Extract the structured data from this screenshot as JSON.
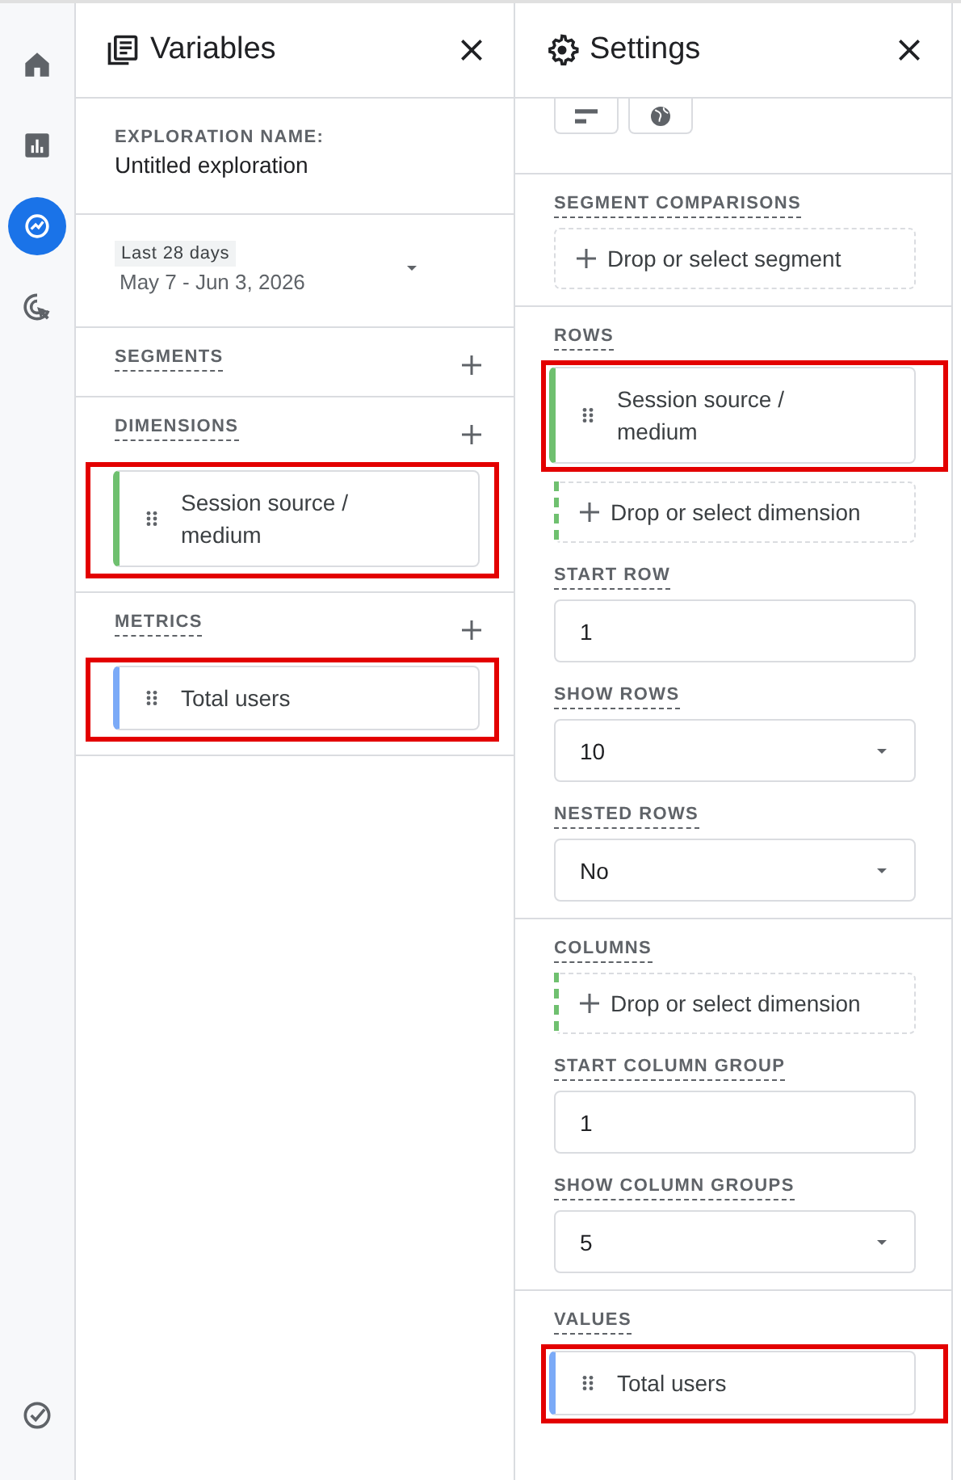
{
  "nav": {
    "items": [
      {
        "kind": "home",
        "selected": false
      },
      {
        "kind": "reports",
        "selected": false
      },
      {
        "kind": "explore",
        "selected": true
      },
      {
        "kind": "advertising",
        "selected": false
      }
    ],
    "bottom_items": [
      {
        "kind": "admin",
        "selected": false
      }
    ]
  },
  "variables_panel": {
    "title": "Variables",
    "exploration_name": {
      "label": "EXPLORATION NAME:",
      "value": "Untitled exploration"
    },
    "date_range": {
      "preset": "Last 28 days",
      "range": "May 7 - Jun 3, 2026"
    },
    "sections": [
      {
        "label": "SEGMENTS"
      },
      {
        "label": "DIMENSIONS",
        "chips": [
          {
            "text": "Session source / medium",
            "kind": "dimension",
            "highlighted": true
          }
        ]
      },
      {
        "label": "METRICS",
        "chips": [
          {
            "text": "Total users",
            "kind": "metric",
            "highlighted": true
          }
        ]
      }
    ]
  },
  "settings_panel": {
    "title": "Settings",
    "groups": [
      {
        "fields": [
          {
            "label": "SEGMENT COMPARISONS",
            "kind": "drop",
            "placeholder": "Drop or select segment"
          }
        ]
      },
      {
        "fields": [
          {
            "label": "ROWS",
            "kind": "drop",
            "color": "#6fc06f",
            "chips": [
              {
                "text": "Session source / medium",
                "kind": "dimension",
                "highlighted": true
              }
            ],
            "placeholder": "Drop or select dimension"
          },
          {
            "label": "START ROW",
            "kind": "input",
            "value": "1"
          },
          {
            "label": "SHOW ROWS",
            "kind": "select",
            "value": "10"
          },
          {
            "label": "NESTED ROWS",
            "kind": "select",
            "value": "No"
          }
        ]
      },
      {
        "fields": [
          {
            "label": "COLUMNS",
            "kind": "drop",
            "color": "#6fc06f",
            "placeholder": "Drop or select dimension"
          },
          {
            "label": "START COLUMN GROUP",
            "kind": "input",
            "value": "1"
          },
          {
            "label": "SHOW COLUMN GROUPS",
            "kind": "select",
            "value": "5"
          }
        ]
      },
      {
        "fields": [
          {
            "label": "VALUES",
            "kind": "drop",
            "chips": [
              {
                "text": "Total users",
                "kind": "metric",
                "highlighted": true
              }
            ]
          }
        ]
      }
    ]
  }
}
